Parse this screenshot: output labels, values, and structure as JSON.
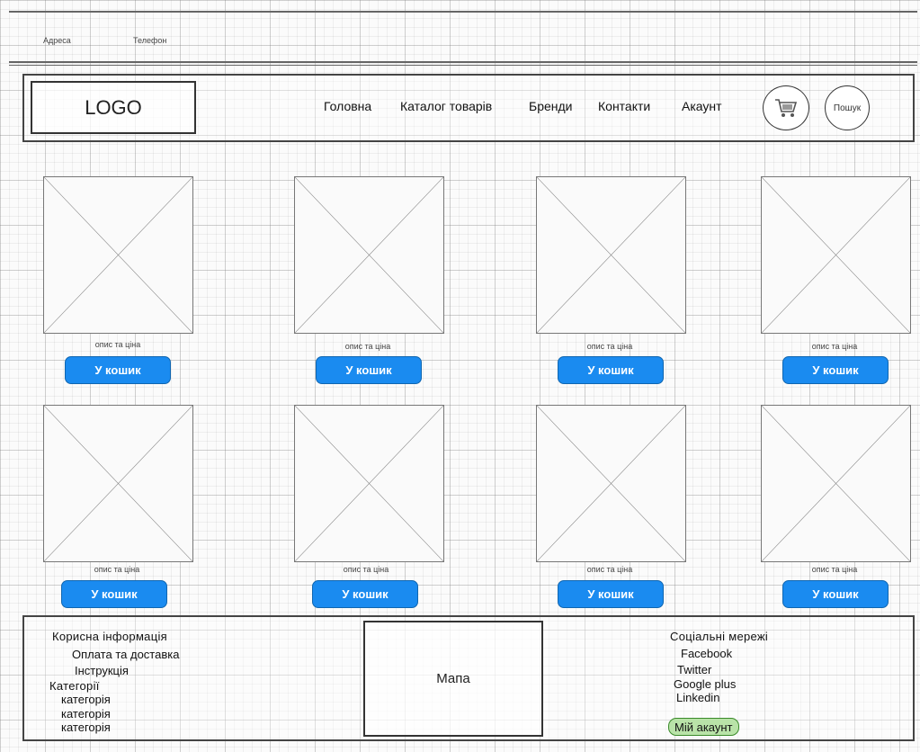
{
  "top_bar": {
    "address": "Адреса",
    "phone": "Телефон"
  },
  "header": {
    "logo": "LOGO",
    "nav": [
      "Головна",
      "Каталог товарів",
      "Бренди",
      "Контакти",
      "Акаунт"
    ],
    "search_label": "Пошук",
    "cart_icon": "cart-icon"
  },
  "products": {
    "description": "опис та ціна",
    "button_label": "У кошик",
    "button_color": "#1a8bf0"
  },
  "footer": {
    "useful_info": {
      "title": "Корисна інформація",
      "items": [
        "Оплата та доставка",
        "Інструкція"
      ]
    },
    "categories": {
      "title": "Категорії",
      "items": [
        "категорія",
        "категорія",
        "категорія"
      ]
    },
    "map": "Мапа",
    "social": {
      "title": "Соціальні мережі",
      "items": [
        "Facebook",
        "Twitter",
        "Google plus",
        "Linkedin"
      ]
    },
    "account_button": "Мій акаунт",
    "account_color": "#b9e3a8"
  }
}
